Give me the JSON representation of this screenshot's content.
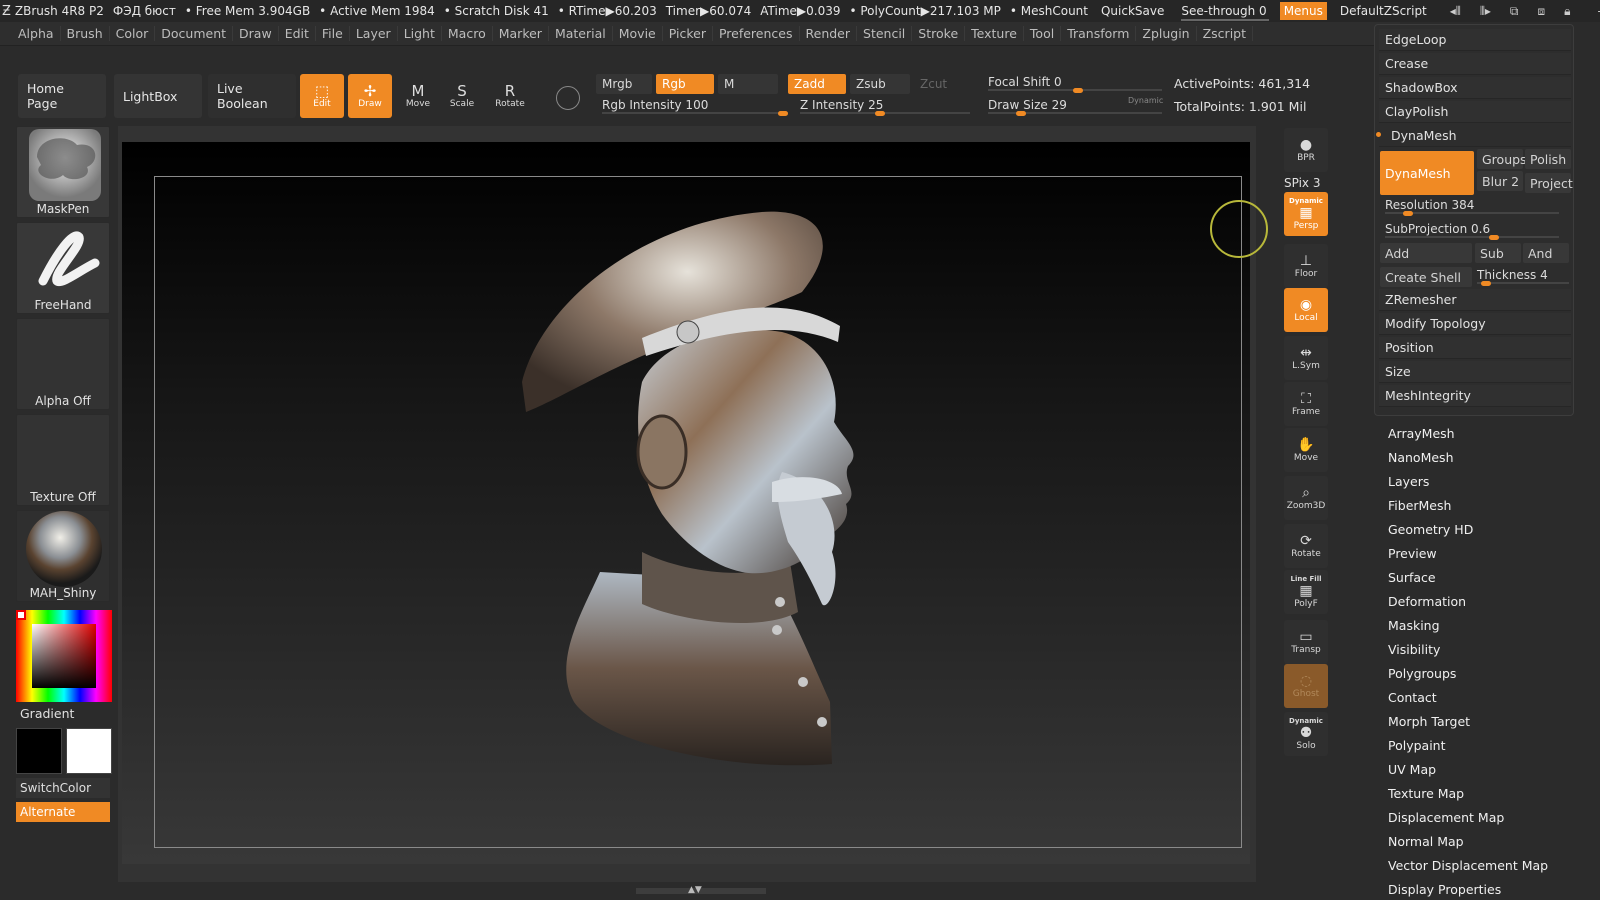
{
  "titlebar": {
    "app": "ZBrush 4R8 P2",
    "doc": "ФЭД бюст",
    "free_mem": "• Free Mem 3.904GB",
    "active_mem": "• Active Mem 1984",
    "scratch": "• Scratch Disk 41",
    "rtime": "• RTime▶60.203",
    "timer": "Timer▶60.074",
    "atime": "ATime▶0.039",
    "polycount": "• PolyCount▶217.103 MP",
    "meshcount": "• MeshCount",
    "quicksave": "QuickSave",
    "seethrough": "See-through  0",
    "menus": "Menus",
    "script": "DefaultZScript"
  },
  "menubar": [
    "Alpha",
    "Brush",
    "Color",
    "Document",
    "Draw",
    "Edit",
    "File",
    "Layer",
    "Light",
    "Macro",
    "Marker",
    "Material",
    "Movie",
    "Picker",
    "Preferences",
    "Render",
    "Stencil",
    "Stroke",
    "Texture",
    "Tool",
    "Transform",
    "Zplugin",
    "Zscript"
  ],
  "shelf": {
    "home": "Home Page",
    "lightbox": "LightBox",
    "live_boolean": "Live Boolean",
    "tools": [
      {
        "label": "Edit",
        "glyph": "⬚",
        "active": true
      },
      {
        "label": "Draw",
        "glyph": "✢",
        "active": true
      },
      {
        "label": "Move",
        "glyph": "M",
        "active": false
      },
      {
        "label": "Scale",
        "glyph": "S",
        "active": false
      },
      {
        "label": "Rotate",
        "glyph": "R",
        "active": false
      }
    ],
    "mrgb": "Mrgb",
    "rgb": "Rgb",
    "m": "M",
    "zadd": "Zadd",
    "zsub": "Zsub",
    "zcut": "Zcut",
    "rgb_intensity": {
      "label": "Rgb Intensity 100",
      "value": 100
    },
    "z_intensity": {
      "label": "Z Intensity 25",
      "value": 25
    },
    "focal_shift": {
      "label": "Focal Shift 0",
      "value": 0
    },
    "draw_size": {
      "label": "Draw Size 29",
      "value": 29
    },
    "dynamic": "Dynamic",
    "active_points": "ActivePoints: 461,314",
    "total_points": "TotalPoints: 1.901 Mil"
  },
  "left": {
    "brush": "MaskPen",
    "stroke": "FreeHand",
    "alpha": "Alpha Off",
    "texture": "Texture Off",
    "material": "MAH_Shiny",
    "gradient": "Gradient",
    "switchcolor": "SwitchColor",
    "alternate": "Alternate"
  },
  "right_tools": [
    {
      "label": "BPR",
      "glyph": "●",
      "active": false
    },
    {
      "label": "Persp",
      "glyph": "▦",
      "active": true,
      "top": "Dynamic"
    },
    {
      "label": "Floor",
      "glyph": "⊥",
      "active": false
    },
    {
      "label": "Local",
      "glyph": "◉",
      "active": true
    },
    {
      "label": "L.Sym",
      "glyph": "⇹",
      "active": false
    },
    {
      "label": "Frame",
      "glyph": "⛶",
      "active": false
    },
    {
      "label": "Move",
      "glyph": "✋",
      "active": false
    },
    {
      "label": "Zoom3D",
      "glyph": "⌕",
      "active": false
    },
    {
      "label": "Rotate",
      "glyph": "⟳",
      "active": false
    },
    {
      "label": "PolyF",
      "glyph": "▦",
      "active": false,
      "top": "Line Fill"
    },
    {
      "label": "Transp",
      "glyph": "▭",
      "active": false
    },
    {
      "label": "Ghost",
      "glyph": "◌",
      "active": false
    },
    {
      "label": "Solo",
      "glyph": "⚉",
      "active": false,
      "top": "Dynamic"
    }
  ],
  "spix": "SPix 3",
  "panel": {
    "rows_top": [
      "EdgeLoop",
      "Crease",
      "ShadowBox",
      "ClayPolish",
      "DynaMesh"
    ],
    "dynamesh_btn": "DynaMesh",
    "groups": "Groups",
    "polish": "Polish",
    "blur": "Blur 2",
    "project": "Project",
    "resolution": {
      "label": "Resolution 384",
      "value": 384
    },
    "subprojection": {
      "label": "SubProjection 0.6",
      "value": 0.6
    },
    "add": "Add",
    "sub": "Sub",
    "and": "And",
    "create_shell": "Create Shell",
    "thickness": {
      "label": "Thickness 4",
      "value": 4
    },
    "rows_bottom": [
      "ZRemesher",
      "Modify Topology",
      "Position",
      "Size",
      "MeshIntegrity"
    ]
  },
  "subpalettes": [
    "ArrayMesh",
    "NanoMesh",
    "Layers",
    "FiberMesh",
    "Geometry HD",
    "Preview",
    "Surface",
    "Deformation",
    "Masking",
    "Visibility",
    "Polygroups",
    "Contact",
    "Morph Target",
    "Polypaint",
    "UV Map",
    "Texture Map",
    "Displacement Map",
    "Normal Map",
    "Vector Displacement Map",
    "Display Properties"
  ],
  "colors": {
    "accent": "#f08a24",
    "bg": "#2b2b2b"
  }
}
